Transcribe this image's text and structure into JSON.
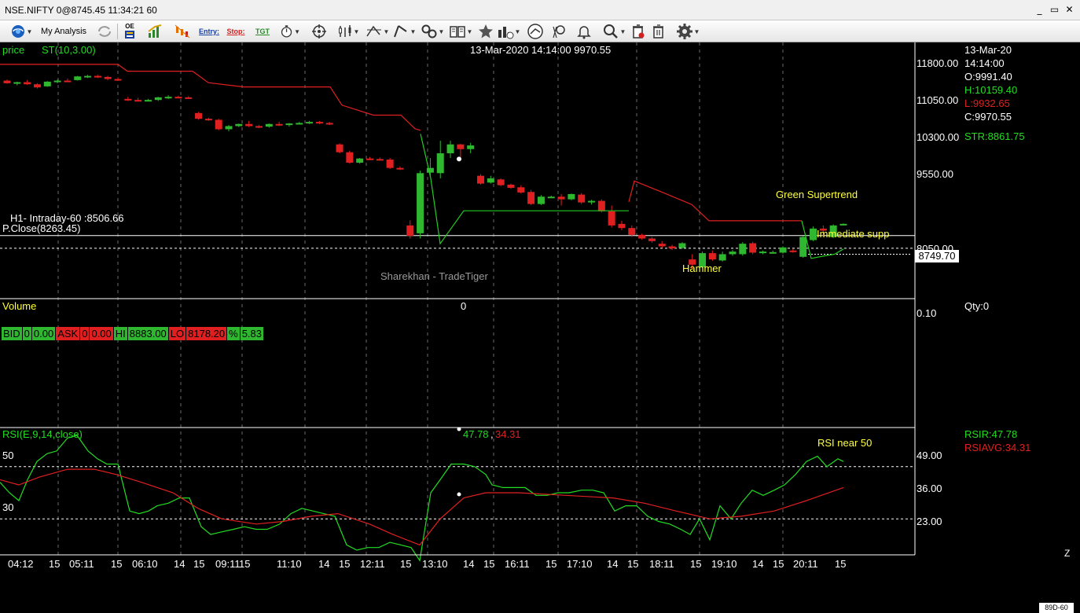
{
  "window": {
    "title": "NSE.NIFTY 0@8745.45 11:34:21 60",
    "minimize": "_",
    "restore": "▭",
    "close": "✕"
  },
  "toolbar": {
    "my_analysis": "My Analysis",
    "oe_label": "OE",
    "entry_label": "Entry:",
    "stop_label": "Stop:",
    "tgt_label": "TGT"
  },
  "price_panel": {
    "name": "price",
    "indicator": "ST(10,3.00)",
    "cursor_readout": "13-Mar-2020 14:14:00 9970.55",
    "h1_label": "H1- Intraday-60 :8506.66",
    "pclose_label": "P.Close(8263.45)",
    "watermark": "Sharekhan - TradeTiger",
    "annotations": [
      "Green Supertrend",
      "Immediate supp",
      "Hammer"
    ],
    "y_ticks": [
      "11800.00",
      "11050.00",
      "10300.00",
      "9550.00",
      "8050.00"
    ],
    "last_price": "8749.70",
    "quote_bar": [
      {
        "text": "BID",
        "color": "green"
      },
      {
        "text": "0",
        "color": "green"
      },
      {
        "text": "0.00",
        "color": "green"
      },
      {
        "text": "ASK",
        "color": "red"
      },
      {
        "text": "0",
        "color": "red"
      },
      {
        "text": "0.00",
        "color": "red"
      },
      {
        "text": "HI",
        "color": "green"
      },
      {
        "text": "8883.00",
        "color": "green"
      },
      {
        "text": "LO",
        "color": "red"
      },
      {
        "text": "8178.20",
        "color": "red"
      },
      {
        "text": "%",
        "color": "green"
      },
      {
        "text": "5.83",
        "color": "green"
      }
    ],
    "info": {
      "date": "13-Mar-20",
      "time": "14:14:00",
      "open": "O:9991.40",
      "high": "H:10159.40",
      "low": "L:9932.65",
      "close": "C:9970.55",
      "str": "STR:8861.75"
    }
  },
  "volume_panel": {
    "name": "Volume",
    "cursor_value": "0",
    "y_tick": "0.10",
    "qty": "Qty:0"
  },
  "rsi_panel": {
    "name": "RSI(E,9,14,close)",
    "value_rsi": "47.78",
    "value_avg": "34.31",
    "annotation": "RSI near 50",
    "left_ticks": [
      "50",
      "30"
    ],
    "y_ticks": [
      "49.00",
      "36.00",
      "23.00"
    ],
    "rsir": "RSIR:47.78",
    "rsiavg": "RSIAVG:34.31"
  },
  "x_axis": [
    "04:12",
    "15",
    "05:11",
    "15",
    "06:10",
    "14",
    "15",
    "09:11",
    "15",
    "11:10",
    "14",
    "15",
    "12:11",
    "15",
    "13:10",
    "14",
    "15",
    "16:11",
    "15",
    "17:10",
    "14",
    "15",
    "18:11",
    "15",
    "19:10",
    "14",
    "15",
    "20:11",
    "15"
  ],
  "corner_label": "89D-60",
  "corner_z": "Z",
  "colors": {
    "up_candle": "#2fb82f",
    "down_candle": "#e02020",
    "supertrend_green": "#22cc22",
    "supertrend_red": "#e02020",
    "rsi_line": "#22dd22",
    "rsi_avg": "#e02020",
    "annotation": "#ffff40"
  },
  "chart_data": {
    "type": "candlestick",
    "price_range": [
      7300,
      12200
    ],
    "candles": [
      {
        "o": 11470,
        "h": 11490,
        "l": 11410,
        "c": 11420
      },
      {
        "o": 11420,
        "h": 11450,
        "l": 11380,
        "c": 11440
      },
      {
        "o": 11440,
        "h": 11480,
        "l": 11390,
        "c": 11400
      },
      {
        "o": 11400,
        "h": 11420,
        "l": 11320,
        "c": 11340
      },
      {
        "o": 11360,
        "h": 11460,
        "l": 11350,
        "c": 11450
      },
      {
        "o": 11450,
        "h": 11490,
        "l": 11420,
        "c": 11470
      },
      {
        "o": 11470,
        "h": 11510,
        "l": 11450,
        "c": 11460
      },
      {
        "o": 11480,
        "h": 11560,
        "l": 11470,
        "c": 11550
      },
      {
        "o": 11550,
        "h": 11580,
        "l": 11520,
        "c": 11560
      },
      {
        "o": 11560,
        "h": 11580,
        "l": 11520,
        "c": 11540
      },
      {
        "o": 11540,
        "h": 11560,
        "l": 11480,
        "c": 11500
      },
      {
        "o": 11500,
        "h": 11530,
        "l": 11470,
        "c": 11490
      },
      {
        "o": 11120,
        "h": 11160,
        "l": 11080,
        "c": 11100
      },
      {
        "o": 11100,
        "h": 11140,
        "l": 11070,
        "c": 11090
      },
      {
        "o": 11090,
        "h": 11120,
        "l": 11070,
        "c": 11100
      },
      {
        "o": 11100,
        "h": 11160,
        "l": 11080,
        "c": 11150
      },
      {
        "o": 11150,
        "h": 11190,
        "l": 11120,
        "c": 11160
      },
      {
        "o": 11160,
        "h": 11180,
        "l": 11140,
        "c": 11150
      },
      {
        "o": 11150,
        "h": 11170,
        "l": 11120,
        "c": 11130
      },
      {
        "o": 10850,
        "h": 10870,
        "l": 10720,
        "c": 10740
      },
      {
        "o": 10740,
        "h": 10760,
        "l": 10700,
        "c": 10720
      },
      {
        "o": 10720,
        "h": 10740,
        "l": 10520,
        "c": 10540
      },
      {
        "o": 10540,
        "h": 10620,
        "l": 10500,
        "c": 10600
      },
      {
        "o": 10600,
        "h": 10650,
        "l": 10580,
        "c": 10640
      },
      {
        "o": 10640,
        "h": 10700,
        "l": 10580,
        "c": 10600
      },
      {
        "o": 10600,
        "h": 10620,
        "l": 10560,
        "c": 10590
      },
      {
        "o": 10590,
        "h": 10650,
        "l": 10570,
        "c": 10640
      },
      {
        "o": 10640,
        "h": 10680,
        "l": 10600,
        "c": 10620
      },
      {
        "o": 10620,
        "h": 10660,
        "l": 10590,
        "c": 10650
      },
      {
        "o": 10650,
        "h": 10680,
        "l": 10630,
        "c": 10660
      },
      {
        "o": 10660,
        "h": 10700,
        "l": 10640,
        "c": 10680
      },
      {
        "o": 10680,
        "h": 10700,
        "l": 10640,
        "c": 10660
      },
      {
        "o": 10660,
        "h": 10680,
        "l": 10620,
        "c": 10640
      },
      {
        "o": 10250,
        "h": 10270,
        "l": 10080,
        "c": 10100
      },
      {
        "o": 10100,
        "h": 10130,
        "l": 9880,
        "c": 9900
      },
      {
        "o": 9900,
        "h": 9990,
        "l": 9880,
        "c": 9980
      },
      {
        "o": 9980,
        "h": 10010,
        "l": 9950,
        "c": 9970
      },
      {
        "o": 9970,
        "h": 10000,
        "l": 9940,
        "c": 9960
      },
      {
        "o": 9960,
        "h": 9990,
        "l": 9780,
        "c": 9800
      },
      {
        "o": 9800,
        "h": 9830,
        "l": 9760,
        "c": 9780
      },
      {
        "o": 8700,
        "h": 8800,
        "l": 8450,
        "c": 8500
      },
      {
        "o": 8550,
        "h": 9750,
        "l": 8450,
        "c": 9700
      },
      {
        "o": 9710,
        "h": 9990,
        "l": 9620,
        "c": 9800
      },
      {
        "o": 9700,
        "h": 10320,
        "l": 9600,
        "c": 10080
      },
      {
        "o": 10080,
        "h": 10320,
        "l": 9990,
        "c": 10250
      },
      {
        "o": 10250,
        "h": 10260,
        "l": 9990,
        "c": 10160
      },
      {
        "o": 10160,
        "h": 10280,
        "l": 10080,
        "c": 10230
      },
      {
        "o": 9650,
        "h": 9680,
        "l": 9480,
        "c": 9500
      },
      {
        "o": 9520,
        "h": 9650,
        "l": 9500,
        "c": 9600
      },
      {
        "o": 9580,
        "h": 9600,
        "l": 9450,
        "c": 9470
      },
      {
        "o": 9480,
        "h": 9500,
        "l": 9400,
        "c": 9420
      },
      {
        "o": 9430,
        "h": 9470,
        "l": 9310,
        "c": 9330
      },
      {
        "o": 9340,
        "h": 9380,
        "l": 9090,
        "c": 9110
      },
      {
        "o": 9110,
        "h": 9280,
        "l": 9090,
        "c": 9250
      },
      {
        "o": 9250,
        "h": 9270,
        "l": 9230,
        "c": 9250
      },
      {
        "o": 9250,
        "h": 9300,
        "l": 9080,
        "c": 9200
      },
      {
        "o": 9200,
        "h": 9310,
        "l": 9180,
        "c": 9300
      },
      {
        "o": 9290,
        "h": 9320,
        "l": 9110,
        "c": 9140
      },
      {
        "o": 9140,
        "h": 9190,
        "l": 9100,
        "c": 9170
      },
      {
        "o": 9170,
        "h": 9200,
        "l": 8950,
        "c": 8970
      },
      {
        "o": 8970,
        "h": 9080,
        "l": 8660,
        "c": 8700
      },
      {
        "o": 8730,
        "h": 8790,
        "l": 8610,
        "c": 8650
      },
      {
        "o": 8650,
        "h": 8700,
        "l": 8480,
        "c": 8520
      },
      {
        "o": 8520,
        "h": 8540,
        "l": 8430,
        "c": 8450
      },
      {
        "o": 8450,
        "h": 8480,
        "l": 8370,
        "c": 8400
      },
      {
        "o": 8350,
        "h": 8400,
        "l": 8270,
        "c": 8300
      },
      {
        "o": 8300,
        "h": 8330,
        "l": 8230,
        "c": 8260
      },
      {
        "o": 8270,
        "h": 8380,
        "l": 8250,
        "c": 8360
      },
      {
        "o": 8050,
        "h": 8150,
        "l": 7870,
        "c": 7950
      },
      {
        "o": 7900,
        "h": 8200,
        "l": 7880,
        "c": 8170
      },
      {
        "o": 8170,
        "h": 8220,
        "l": 8020,
        "c": 8050
      },
      {
        "o": 8030,
        "h": 8200,
        "l": 8010,
        "c": 8150
      },
      {
        "o": 8150,
        "h": 8230,
        "l": 8120,
        "c": 8200
      },
      {
        "o": 8150,
        "h": 8380,
        "l": 8120,
        "c": 8350
      },
      {
        "o": 8360,
        "h": 8390,
        "l": 8150,
        "c": 8180
      },
      {
        "o": 8180,
        "h": 8220,
        "l": 8150,
        "c": 8200
      },
      {
        "o": 8180,
        "h": 8220,
        "l": 8160,
        "c": 8190
      },
      {
        "o": 8180,
        "h": 8300,
        "l": 8160,
        "c": 8280
      },
      {
        "o": 8220,
        "h": 8250,
        "l": 8180,
        "c": 8200
      },
      {
        "o": 8100,
        "h": 8500,
        "l": 8080,
        "c": 8480
      },
      {
        "o": 8420,
        "h": 8680,
        "l": 8400,
        "c": 8640
      },
      {
        "o": 8640,
        "h": 8700,
        "l": 8500,
        "c": 8600
      },
      {
        "o": 8480,
        "h": 8720,
        "l": 8460,
        "c": 8700
      },
      {
        "o": 8720,
        "h": 8740,
        "l": 8700,
        "c": 8730
      }
    ],
    "supertrend_red": [
      [
        0,
        11780
      ],
      [
        150,
        11780
      ],
      [
        162,
        11650
      ],
      [
        245,
        11650
      ],
      [
        265,
        11430
      ],
      [
        310,
        11350
      ],
      [
        420,
        11350
      ],
      [
        435,
        11000
      ],
      [
        475,
        10810
      ],
      [
        510,
        10810
      ],
      [
        528,
        10550
      ],
      [
        535,
        10520
      ]
    ],
    "supertrend_green": [
      [
        535,
        10450
      ],
      [
        548,
        9600
      ],
      [
        560,
        8350
      ],
      [
        590,
        8980
      ],
      [
        800,
        8980
      ]
    ],
    "supertrend_red2": [
      [
        800,
        9150
      ],
      [
        807,
        9550
      ],
      [
        840,
        9350
      ],
      [
        880,
        9100
      ],
      [
        902,
        8790
      ],
      [
        1020,
        8790
      ]
    ],
    "supertrend_green2": [
      [
        1020,
        8790
      ],
      [
        1032,
        8070
      ],
      [
        1050,
        8120
      ],
      [
        1062,
        8150
      ],
      [
        1073,
        8250
      ]
    ],
    "h1_value": 8506.66,
    "prev_close": 8263.45,
    "immediate_support": 8150,
    "rsi_range": [
      15,
      65
    ],
    "rsi": [
      [
        0,
        44
      ],
      [
        12,
        40
      ],
      [
        24,
        37
      ],
      [
        35,
        45
      ],
      [
        47,
        52
      ],
      [
        60,
        55
      ],
      [
        72,
        56
      ],
      [
        86,
        61
      ],
      [
        98,
        62
      ],
      [
        112,
        56
      ],
      [
        124,
        53
      ],
      [
        136,
        51
      ],
      [
        150,
        51
      ],
      [
        165,
        33
      ],
      [
        177,
        32
      ],
      [
        189,
        33
      ],
      [
        200,
        35
      ],
      [
        214,
        36
      ],
      [
        228,
        38
      ],
      [
        241,
        38
      ],
      [
        256,
        27
      ],
      [
        268,
        24
      ],
      [
        282,
        25
      ],
      [
        297,
        26
      ],
      [
        311,
        27
      ],
      [
        326,
        26
      ],
      [
        340,
        26
      ],
      [
        356,
        28
      ],
      [
        370,
        32
      ],
      [
        384,
        34
      ],
      [
        398,
        33
      ],
      [
        412,
        32
      ],
      [
        426,
        31
      ],
      [
        441,
        20
      ],
      [
        454,
        18
      ],
      [
        468,
        19
      ],
      [
        482,
        19
      ],
      [
        496,
        21
      ],
      [
        510,
        20
      ],
      [
        523,
        19
      ],
      [
        534,
        14
      ],
      [
        548,
        40
      ],
      [
        560,
        45
      ],
      [
        574,
        51
      ],
      [
        590,
        51
      ],
      [
        604,
        50
      ],
      [
        618,
        47
      ],
      [
        626,
        43
      ],
      [
        640,
        42
      ],
      [
        654,
        42
      ],
      [
        668,
        42
      ],
      [
        682,
        39
      ],
      [
        696,
        39
      ],
      [
        710,
        40
      ],
      [
        724,
        40
      ],
      [
        740,
        41
      ],
      [
        754,
        41
      ],
      [
        768,
        40
      ],
      [
        782,
        33
      ],
      [
        796,
        35
      ],
      [
        810,
        35
      ],
      [
        824,
        31
      ],
      [
        838,
        29
      ],
      [
        852,
        28
      ],
      [
        866,
        26
      ],
      [
        878,
        24
      ],
      [
        890,
        30
      ],
      [
        903,
        22
      ],
      [
        916,
        35
      ],
      [
        930,
        30
      ],
      [
        943,
        36
      ],
      [
        957,
        41
      ],
      [
        971,
        39
      ],
      [
        985,
        41
      ],
      [
        998,
        43
      ],
      [
        1012,
        47
      ],
      [
        1026,
        52
      ],
      [
        1040,
        54
      ],
      [
        1052,
        50
      ],
      [
        1066,
        53
      ],
      [
        1073,
        52
      ]
    ],
    "rsi_avg": [
      [
        0,
        45
      ],
      [
        24,
        43
      ],
      [
        50,
        46
      ],
      [
        86,
        49
      ],
      [
        120,
        49
      ],
      [
        148,
        47
      ],
      [
        180,
        44
      ],
      [
        220,
        40
      ],
      [
        252,
        34
      ],
      [
        282,
        30
      ],
      [
        326,
        28
      ],
      [
        360,
        29
      ],
      [
        396,
        31
      ],
      [
        430,
        32
      ],
      [
        470,
        28
      ],
      [
        500,
        24
      ],
      [
        534,
        20
      ],
      [
        560,
        30
      ],
      [
        590,
        38
      ],
      [
        618,
        40
      ],
      [
        660,
        40
      ],
      [
        720,
        39
      ],
      [
        780,
        38
      ],
      [
        820,
        36
      ],
      [
        860,
        33
      ],
      [
        903,
        30
      ],
      [
        943,
        31
      ],
      [
        985,
        33
      ],
      [
        1026,
        37
      ],
      [
        1073,
        42
      ]
    ]
  }
}
